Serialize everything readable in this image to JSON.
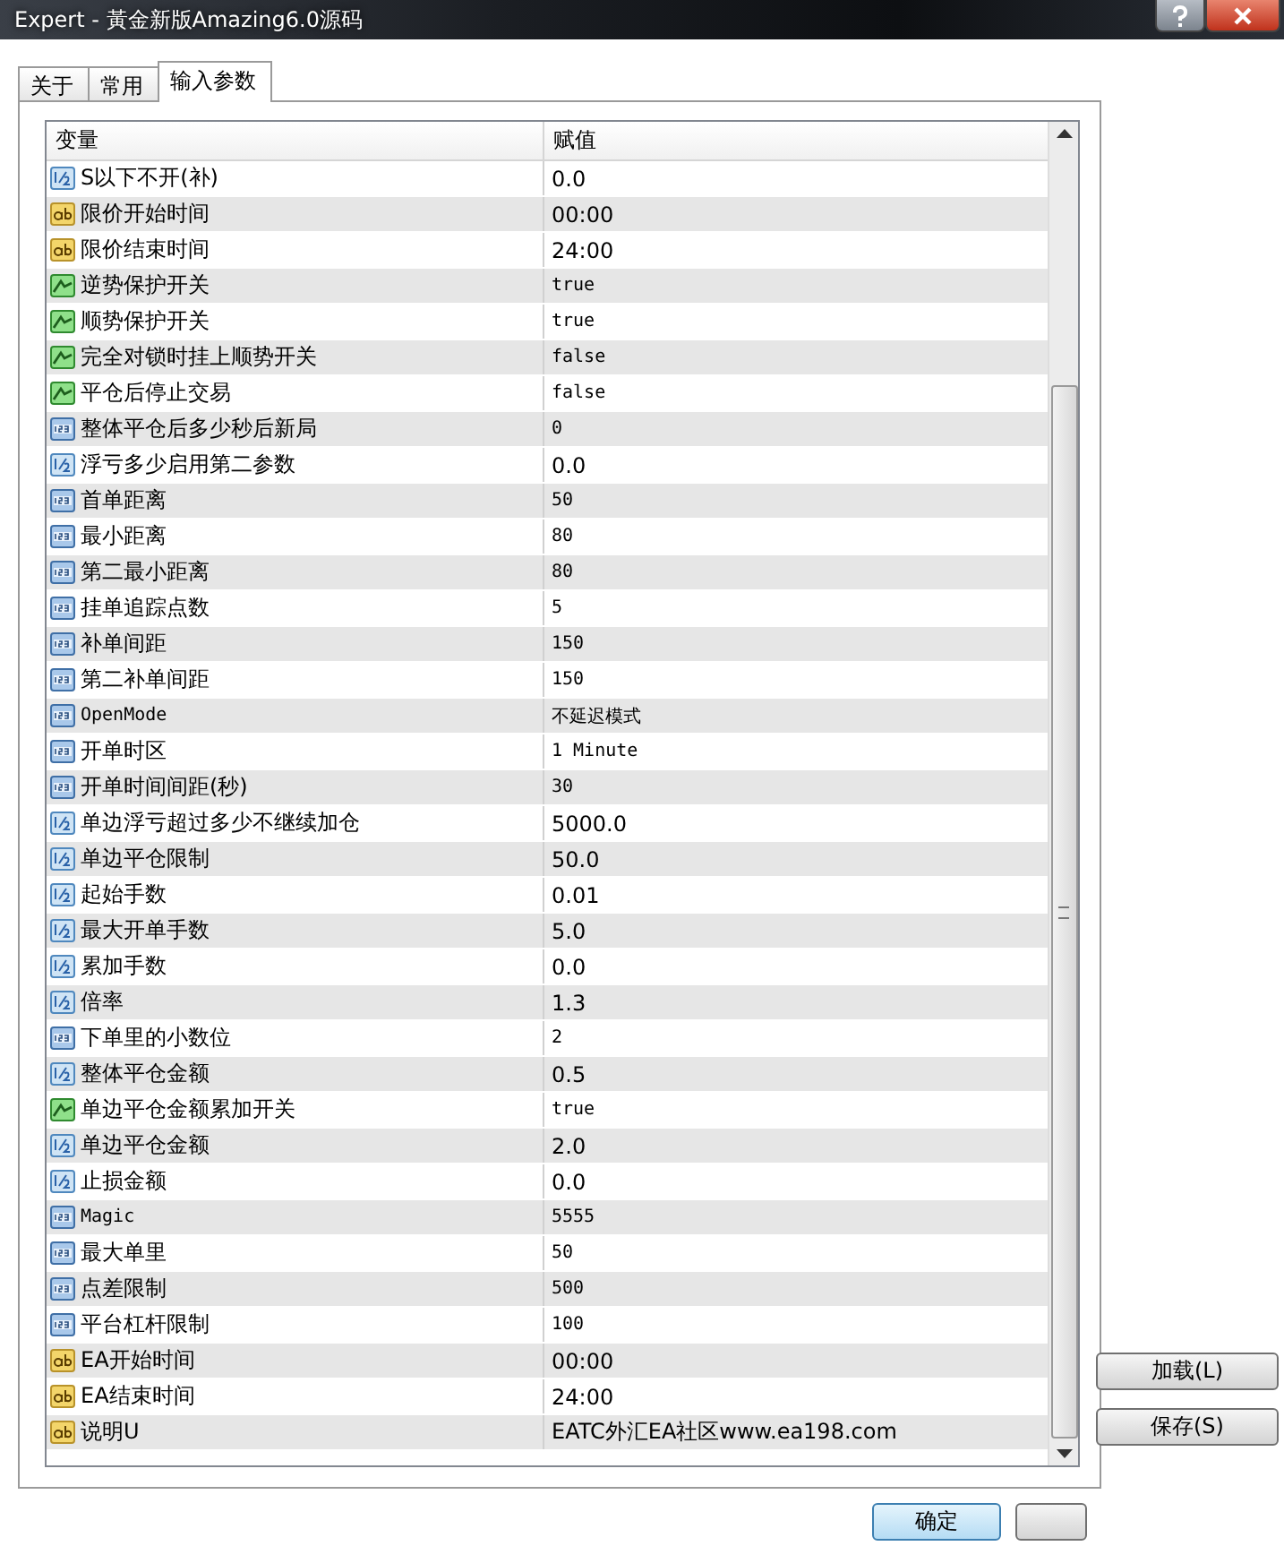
{
  "window": {
    "title": "Expert - 黃金新版Amazing6.0源码"
  },
  "tabs": [
    {
      "label": "关于",
      "selected": false
    },
    {
      "label": "常用",
      "selected": false
    },
    {
      "label": "输入参数",
      "selected": true
    }
  ],
  "table": {
    "columns": [
      "变量",
      "赋值"
    ],
    "rows": [
      {
        "kind": "double",
        "name": "S以下不开(补)",
        "value": "0.0"
      },
      {
        "kind": "string",
        "name": "限价开始时间",
        "value": "00:00"
      },
      {
        "kind": "string",
        "name": "限价结束时间",
        "value": "24:00"
      },
      {
        "kind": "bool",
        "name": "逆势保护开关",
        "value": "true"
      },
      {
        "kind": "bool",
        "name": "顺势保护开关",
        "value": "true"
      },
      {
        "kind": "bool",
        "name": "完全对锁时挂上顺势开关",
        "value": "false"
      },
      {
        "kind": "bool",
        "name": "平仓后停止交易",
        "value": "false"
      },
      {
        "kind": "int",
        "name": "整体平仓后多少秒后新局",
        "value": "0"
      },
      {
        "kind": "double",
        "name": "浮亏多少启用第二参数",
        "value": "0.0"
      },
      {
        "kind": "int",
        "name": "首单距离",
        "value": "50"
      },
      {
        "kind": "int",
        "name": "最小距离",
        "value": "80"
      },
      {
        "kind": "int",
        "name": "第二最小距离",
        "value": "80"
      },
      {
        "kind": "int",
        "name": "挂单追踪点数",
        "value": "5"
      },
      {
        "kind": "int",
        "name": "补单间距",
        "value": "150"
      },
      {
        "kind": "int",
        "name": "第二补单间距",
        "value": "150"
      },
      {
        "kind": "int",
        "name": "OpenMode",
        "value": "不延迟模式"
      },
      {
        "kind": "int",
        "name": "开单时区",
        "value": "1 Minute"
      },
      {
        "kind": "int",
        "name": "开单时间间距(秒)",
        "value": "30"
      },
      {
        "kind": "double",
        "name": "单边浮亏超过多少不继续加仓",
        "value": "5000.0"
      },
      {
        "kind": "double",
        "name": "单边平仓限制",
        "value": "50.0"
      },
      {
        "kind": "double",
        "name": "起始手数",
        "value": "0.01"
      },
      {
        "kind": "double",
        "name": "最大开单手数",
        "value": "5.0"
      },
      {
        "kind": "double",
        "name": "累加手数",
        "value": "0.0"
      },
      {
        "kind": "double",
        "name": "倍率",
        "value": "1.3"
      },
      {
        "kind": "int",
        "name": "下单里的小数位",
        "value": "2"
      },
      {
        "kind": "double",
        "name": "整体平仓金额",
        "value": "0.5"
      },
      {
        "kind": "bool",
        "name": "单边平仓金额累加开关",
        "value": "true"
      },
      {
        "kind": "double",
        "name": "单边平仓金额",
        "value": "2.0"
      },
      {
        "kind": "double",
        "name": "止损金额",
        "value": "0.0"
      },
      {
        "kind": "int",
        "name": "Magic",
        "value": "5555"
      },
      {
        "kind": "int",
        "name": "最大单里",
        "value": "50"
      },
      {
        "kind": "int",
        "name": "点差限制",
        "value": "500"
      },
      {
        "kind": "int",
        "name": "平台杠杆限制",
        "value": "100"
      },
      {
        "kind": "string",
        "name": "EA开始时间",
        "value": "00:00"
      },
      {
        "kind": "string",
        "name": "EA结束时间",
        "value": "24:00"
      },
      {
        "kind": "string",
        "name": "说明U",
        "value": "EATC外汇EA社区www.ea198.com"
      }
    ]
  },
  "side_buttons": [
    "加载(L)",
    "保存(S)"
  ],
  "bottom_buttons": [
    "确定"
  ]
}
